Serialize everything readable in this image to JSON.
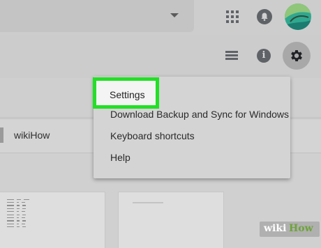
{
  "menu": {
    "items": [
      {
        "label": "Settings"
      },
      {
        "label": "Download Backup and Sync for Windows"
      },
      {
        "label": "Keyboard shortcuts"
      },
      {
        "label": "Help"
      }
    ]
  },
  "file_row": {
    "name": "wikiHow"
  },
  "watermark": {
    "prefix": "wiki",
    "suffix": "How"
  },
  "icons": {
    "search_dropdown": "caret-down-icon",
    "apps": "apps-grid-icon",
    "notifications": "bell-icon",
    "list_view": "list-view-icon",
    "info": "info-icon",
    "settings": "gear-icon"
  },
  "colors": {
    "highlight": "#22e025",
    "icon": "#5f6368",
    "menu_bg": "#d4d4d4"
  }
}
